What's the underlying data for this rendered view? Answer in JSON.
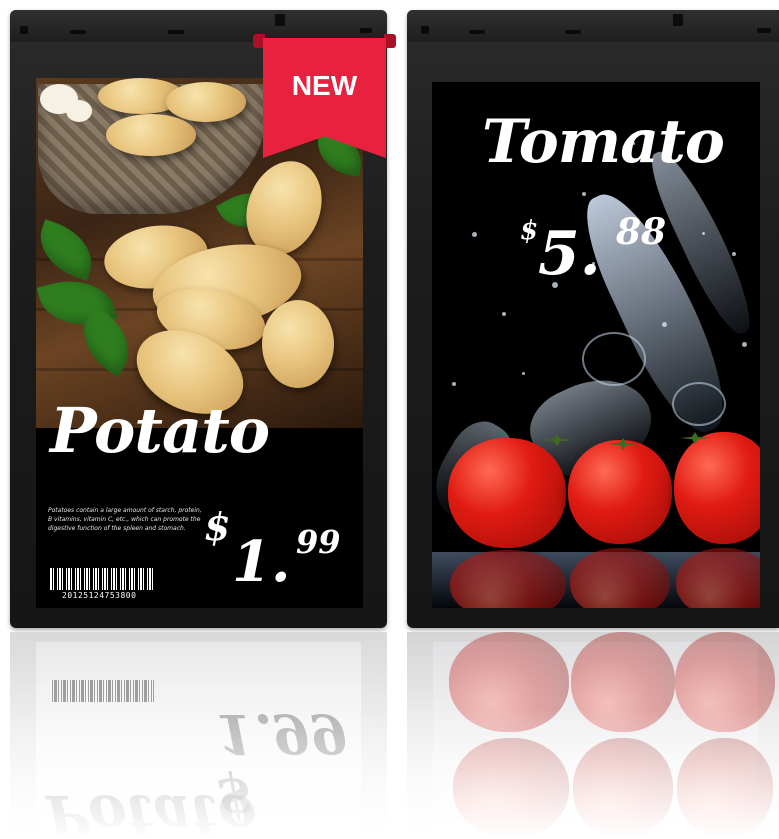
{
  "displays": {
    "potato": {
      "badge": "NEW",
      "name": "Potato",
      "description": "Potatoes contain a large amount of starch, protein, B vitamins, vitamin C, etc., which can promote the digestive function of the spleen and stomach.",
      "price": {
        "currency": "$",
        "integer": "1.",
        "decimal": "99"
      },
      "barcode_number": "20125124753800"
    },
    "tomato": {
      "name": "Tomato",
      "price": {
        "currency": "$",
        "integer": "5.",
        "decimal": "88"
      }
    }
  },
  "colors": {
    "ribbon": "#e8213f",
    "bezel": "#1c1c1c",
    "text": "#ffffff"
  }
}
